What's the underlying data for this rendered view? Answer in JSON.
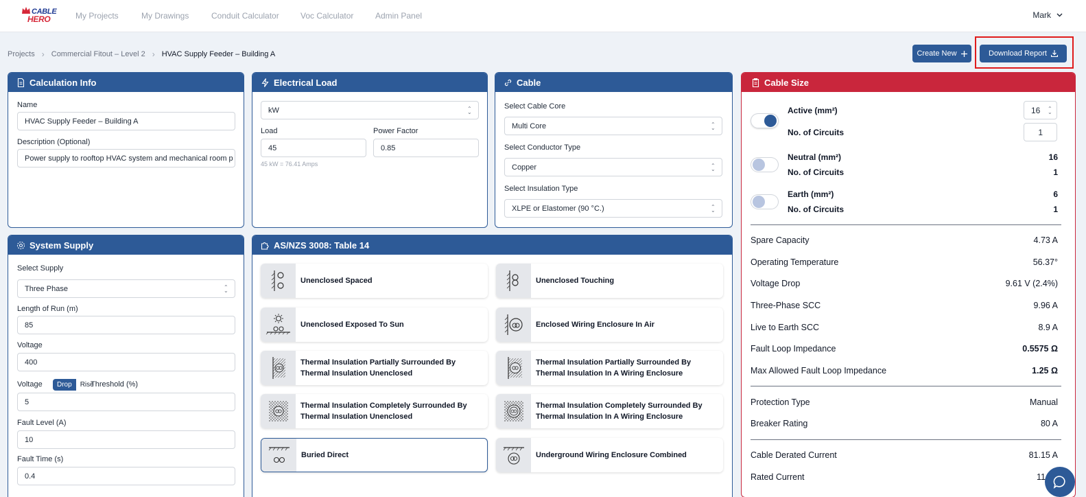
{
  "brand": {
    "line1": "CABLE",
    "line2": "HERO",
    "primary": "#2d5a97",
    "danger": "#c9263c"
  },
  "nav": {
    "links": [
      "My Projects",
      "My Drawings",
      "Conduit Calculator",
      "Voc Calculator",
      "Admin Panel"
    ],
    "user": "Mark"
  },
  "breadcrumb": {
    "items": [
      "Projects",
      "Commercial Fitout – Level 2",
      "HVAC Supply Feeder – Building A"
    ]
  },
  "actions": {
    "create_new": "Create New",
    "download_report": "Download Report"
  },
  "calc_info": {
    "title": "Calculation Info",
    "name_label": "Name",
    "name_value": "HVAC Supply Feeder – Building A",
    "desc_label": "Description (Optional)",
    "desc_value": "Power supply to rooftop HVAC system and mechanical room p"
  },
  "electrical_load": {
    "title": "Electrical Load",
    "unit": "kW",
    "load_label": "Load",
    "load_value": "45",
    "pf_label": "Power Factor",
    "pf_value": "0.85",
    "hint": "45 kW = 76.41 Amps"
  },
  "cable": {
    "title": "Cable",
    "core_label": "Select Cable Core",
    "core_value": "Multi Core",
    "conductor_label": "Select Conductor Type",
    "conductor_value": "Copper",
    "insulation_label": "Select Insulation Type",
    "insulation_value": "XLPE or Elastomer (90 °C.)"
  },
  "system_supply": {
    "title": "System Supply",
    "supply_label": "Select Supply",
    "supply_value": "Three Phase",
    "length_label": "Length of Run (m)",
    "length_value": "85",
    "voltage_label": "Voltage",
    "voltage_value": "400",
    "vd_prefix": "Voltage",
    "vd_opt_drop": "Drop",
    "vd_opt_rise": "Rise",
    "vd_suffix": "Threshold (%)",
    "threshold_value": "5",
    "fault_level_label": "Fault Level (A)",
    "fault_level_value": "10",
    "fault_time_label": "Fault Time (s)",
    "fault_time_value": "0.4"
  },
  "table14": {
    "title": "AS/NZS 3008: Table 14",
    "options": [
      "Unenclosed Spaced",
      "Unenclosed Touching",
      "Unenclosed Exposed To Sun",
      "Enclosed Wiring Enclosure In Air",
      "Thermal Insulation Partially Surrounded By Thermal Insulation Unenclosed",
      "Thermal Insulation Partially Surrounded By Thermal Insulation In A Wiring Enclosure",
      "Thermal Insulation Completely Surrounded By Thermal Insulation Unenclosed",
      "Thermal Insulation Completely Surrounded By Thermal Insulation In A Wiring Enclosure",
      "Buried Direct",
      "Underground Wiring Enclosure Combined"
    ],
    "selected": "Buried Direct"
  },
  "cable_size": {
    "title": "Cable Size",
    "active_label": "Active (mm²)",
    "active_value": "16",
    "active_circuits_label": "No. of Circuits",
    "active_circuits_value": "1",
    "neutral_label": "Neutral (mm²)",
    "neutral_value": "16",
    "neutral_circuits_label": "No. of Circuits",
    "neutral_circuits_value": "1",
    "earth_label": "Earth (mm²)",
    "earth_value": "6",
    "earth_circuits_label": "No. of Circuits",
    "earth_circuits_value": "1",
    "results": [
      {
        "label": "Spare Capacity",
        "value": "4.73 A"
      },
      {
        "label": "Operating Temperature",
        "value": "56.37°"
      },
      {
        "label": "Voltage Drop",
        "value": "9.61 V (2.4%)"
      },
      {
        "label": "Three-Phase SCC",
        "value": "9.96 A"
      },
      {
        "label": "Live to Earth SCC",
        "value": "8.9 A"
      },
      {
        "label": "Fault Loop Impedance",
        "value": "0.5575 Ω"
      },
      {
        "label": "Max Allowed Fault Loop Impedance",
        "value": "1.25 Ω"
      }
    ],
    "protection": [
      {
        "label": "Protection Type",
        "value": "Manual"
      },
      {
        "label": "Breaker Rating",
        "value": "80 A"
      }
    ],
    "currents": [
      {
        "label": "Cable Derated Current",
        "value": "81.15 A"
      },
      {
        "label": "Rated Current",
        "value": "11"
      }
    ]
  }
}
